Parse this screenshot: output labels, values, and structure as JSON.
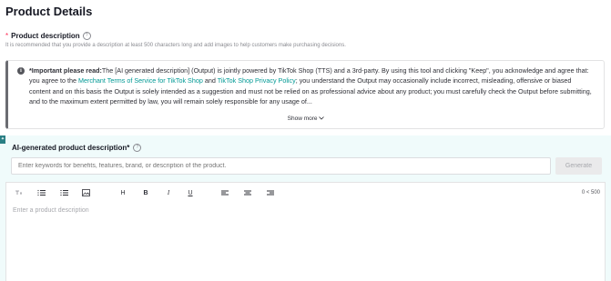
{
  "section_title": "Product Details",
  "description": {
    "required_mark": "*",
    "label": "Product description",
    "hint": "It is recommended that you provide a description at least 500 characters long and add images to help customers make purchasing decisions."
  },
  "notice": {
    "bold": "*Important please read:",
    "text1": "The [AI generated description] (Output) is jointly powered by TikTok Shop (TTS) and a 3rd-party. By using this tool and clicking \"Keep\", you acknowledge and agree that: you agree to the ",
    "link1": "Merchant Terms of Service for TikTok Shop",
    "and": " and ",
    "link2": "TikTok Shop Privacy Policy",
    "text2": "; you understand the Output may occasionally include incorrect, misleading, offensive or biased content and on this basis the Output is solely intended as a suggestion and must not be relied on as professional advice about any product; you must carefully check the Output before submitting, and to the maximum extent permitted by law, you will remain solely responsible for any usage of...",
    "show_more": "Show more"
  },
  "ai": {
    "label": "AI-generated product description*",
    "keyword_placeholder": "Enter keywords for benefits, features, brand, or description of the product.",
    "generate": "Generate"
  },
  "editor": {
    "placeholder": "Enter a product description",
    "counter": "0 < 500",
    "tools": {
      "heading": "H",
      "bold": "B",
      "italic": "I",
      "underline": "U"
    }
  },
  "colors": {
    "link": "#009995",
    "ai_background": "#f0fbfb",
    "required": "#fe2c55"
  }
}
